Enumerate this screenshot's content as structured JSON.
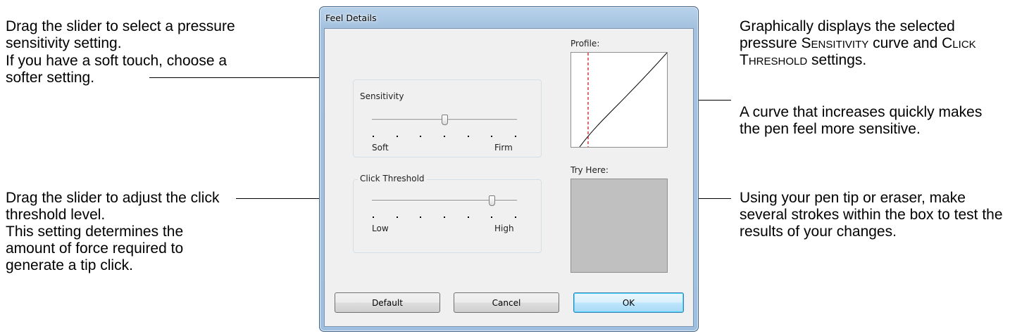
{
  "annotations": {
    "sensitivity_p1": "Drag the slider to select a pressure sensitivity setting.",
    "sensitivity_p2": "If you have a soft touch, choose a softer setting.",
    "threshold_p1": "Drag the slider to adjust the click threshold level.",
    "threshold_p2": "This setting determines the amount of force required to generate a tip click.",
    "profile_p1_a": "Graphically displays the selected pressure ",
    "profile_p1_b": "Sensitivity",
    "profile_p1_c": " curve and ",
    "profile_p1_d": "Click Threshold",
    "profile_p1_e": " settings.",
    "profile_p2": "A curve that increases quickly makes the pen feel more sensitive.",
    "tryhere_p1": "Using your pen tip or eraser, make several strokes within the box to test the results of your changes."
  },
  "dialog": {
    "title": "Feel Details",
    "sensitivity": {
      "label": "Sensitivity",
      "min_label": "Soft",
      "max_label": "Firm",
      "tick_count": 7,
      "value_fraction": 0.5
    },
    "click_threshold": {
      "label": "Click Threshold",
      "min_label": "Low",
      "max_label": "High",
      "tick_count": 7,
      "value_fraction": 0.83
    },
    "profile_label": "Profile:",
    "try_here_label": "Try Here:",
    "buttons": {
      "default": "Default",
      "cancel": "Cancel",
      "ok": "OK"
    },
    "colors": {
      "profile_threshold_line": "#d11a1a",
      "profile_curve": "#000000",
      "try_area": "#c0c0c0"
    }
  }
}
